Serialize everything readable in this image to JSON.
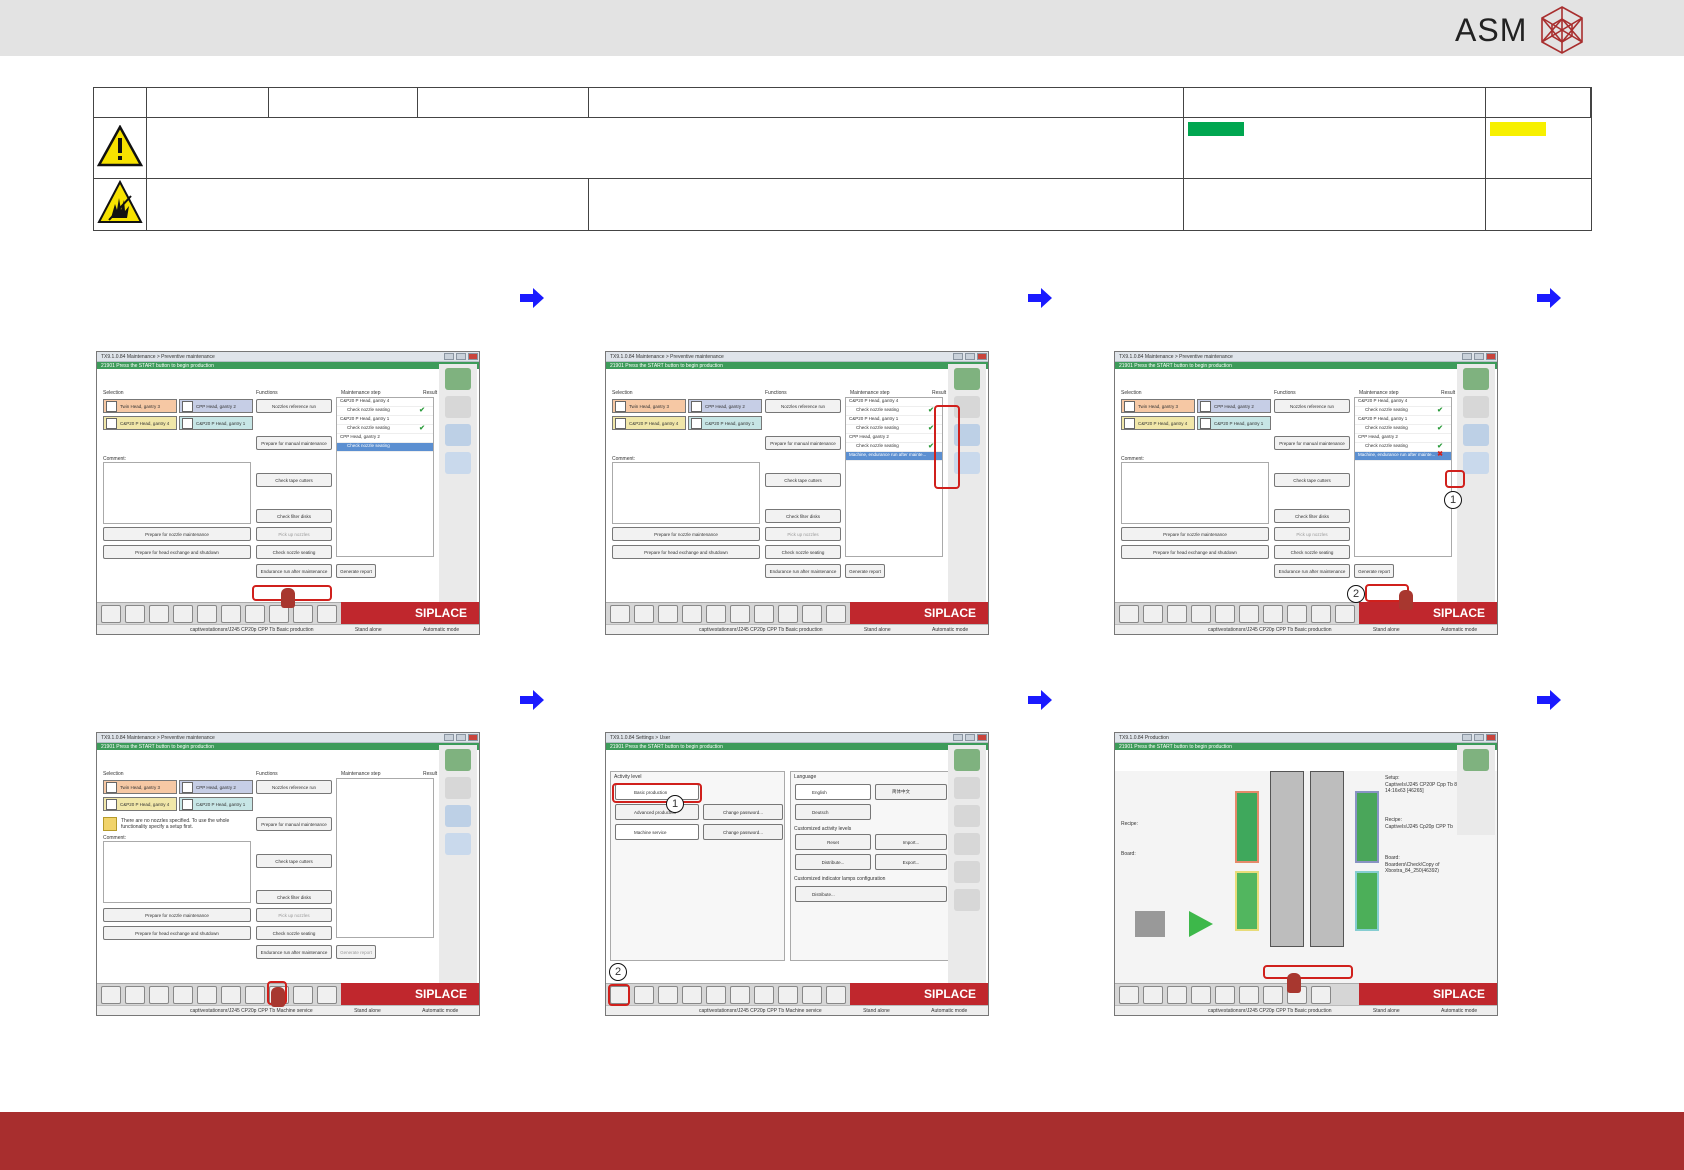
{
  "header": {
    "logo_text": "ASM"
  },
  "colors": {
    "brand_red": "#a82e2e",
    "siplace_red": "#c0272d",
    "status_green": "#00a650",
    "highlight_yellow": "#f7f000",
    "arrow_blue": "#1a1aff",
    "window_green": "#3d9b5a"
  },
  "table": {
    "warning_icon": "warning-triangle-icon",
    "esd_icon": "esd-hand-icon"
  },
  "screens": {
    "common": {
      "status_text": "21901 Press the START button to begin production",
      "siplace": "SIPLACE",
      "footer_user": "captivestationsnr/J245 CP20p CPP Tb",
      "footer_stand": "Stand alone",
      "footer_mode": "Automatic mode"
    },
    "maint": {
      "title": "TX9.1.0.84 Maintenance > Preventive maintenance",
      "selection_label": "Selection",
      "functions_label": "Functions",
      "step_label": "Maintenance step",
      "result_label": "Result",
      "comment_label": "Comment:",
      "gantries": [
        "Twin Head, gantry 3",
        "CPP Head, gantry 2",
        "C&P20 P Head, gantry 4",
        "C&P20 P Head, gantry 1"
      ],
      "functions": [
        "Nozzles reference run",
        "Prepare for manual maintenance",
        "Check tape cutters",
        "Check filter disks",
        "Pick up nozzles",
        "Check nozzle seating",
        "Endurance run after maintenance",
        "Generate report"
      ],
      "left_buttons": [
        "Prepare for nozzle maintenance",
        "Prepare for head exchange and shutdown"
      ],
      "steps": [
        "C&P20 P Head, gantry 4",
        "Check nozzle seating",
        "C&P20 P Head, gantry 1",
        "Check nozzle seating",
        "CPP Head, gantry 2",
        "Check nozzle seating"
      ],
      "endurance_step": "Machine, endurance run after mainte...",
      "no_nozzles_note": "There are no nozzles specified. To use the whole functionality specify a setup first.",
      "mode_basic": "Basic production",
      "mode_service": "Machine service"
    },
    "settings": {
      "title": "TX9.1.0.84 Settings > User",
      "activity_label": "Activity level",
      "levels": [
        "Basic production",
        "Advanced production",
        "Machine service"
      ],
      "change_pw": "Change password...",
      "language_label": "Language",
      "languages": [
        "English",
        "简体中文",
        "Deutsch"
      ],
      "custom_levels": "Customized activity levels",
      "reset": "Reset",
      "import": "Import...",
      "distribute": "Distribute...",
      "export": "Export...",
      "indicator_label": "Customized indicator lamps configuration"
    },
    "production": {
      "title": "TX9.1.0.84 Production",
      "recipe_label": "Recipe:",
      "board_label": "Board:",
      "setup_label": "Setup:",
      "setup_value": "CaptiveIs\\J245 CP20P Cpp Tb 8-16-05-10 14:16x63 [46265]",
      "recipe_value": "CaptiveIs\\J245 Cp20p CPP Tb",
      "board_value": "Boarders\\Check\\Copy of Xboxtra_84_250(46392)"
    },
    "callouts": [
      "1",
      "2"
    ]
  }
}
